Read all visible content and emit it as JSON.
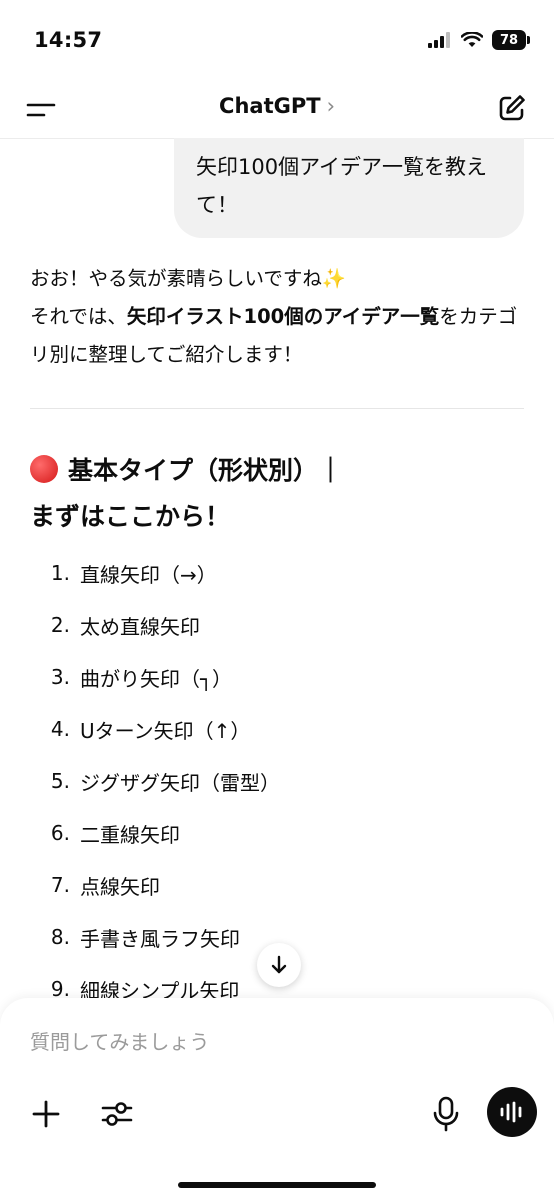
{
  "status_bar": {
    "time": "14:57",
    "battery": "78"
  },
  "header": {
    "title": "ChatGPT",
    "chevron": "›"
  },
  "user_message": "矢印100個アイデア一覧を教えて！",
  "answer": {
    "line1": "おお！やる気が素晴らしいですね✨",
    "line2_prefix": "それでは、",
    "line2_bold": "矢印イラスト100個のアイデア一覧",
    "line2_suffix": "をカテゴリ別に整理してご紹介します！"
  },
  "section": {
    "title_line1": "基本タイプ（形状別）｜",
    "title_line2": "まずはここから！"
  },
  "list_items": [
    {
      "num": "1.",
      "text": "直線矢印（→）"
    },
    {
      "num": "2.",
      "text": "太め直線矢印"
    },
    {
      "num": "3.",
      "text": "曲がり矢印（┐）"
    },
    {
      "num": "4.",
      "text": "Uターン矢印（↑）"
    },
    {
      "num": "5.",
      "text": "ジグザグ矢印（雷型）"
    },
    {
      "num": "6.",
      "text": "二重線矢印"
    },
    {
      "num": "7.",
      "text": "点線矢印"
    },
    {
      "num": "8.",
      "text": "手書き風ラフ矢印"
    },
    {
      "num": "9.",
      "text": "細線シンプル矢印"
    }
  ],
  "composer": {
    "placeholder": "質問してみましょう"
  },
  "icons": {
    "menu": "menu-icon",
    "new_chat": "edit-icon",
    "scroll_down": "arrow-down-icon",
    "plus": "plus-icon",
    "tools": "sliders-icon",
    "mic": "microphone-icon",
    "voice": "voice-waveform-icon"
  },
  "colors": {
    "user_bubble": "#f1f1f1",
    "accent_dark": "#0d0d0d",
    "red_dot": "#d41818"
  }
}
